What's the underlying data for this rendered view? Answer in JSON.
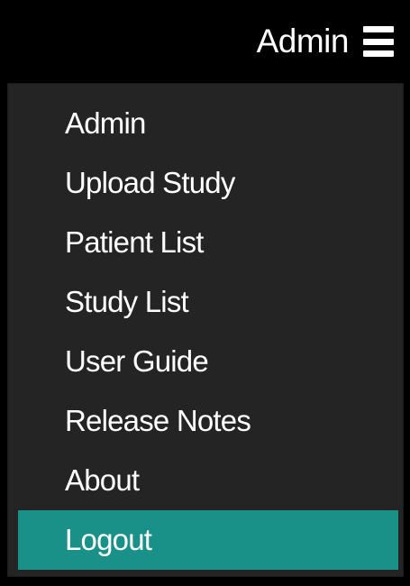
{
  "header": {
    "user_label": "Admin",
    "menu_icon": "hamburger-icon"
  },
  "menu": {
    "items": [
      {
        "label": "Admin"
      },
      {
        "label": "Upload Study"
      },
      {
        "label": "Patient List"
      },
      {
        "label": "Study List"
      },
      {
        "label": "User Guide"
      },
      {
        "label": "Release Notes"
      },
      {
        "label": "About"
      },
      {
        "label": "Logout",
        "highlighted": true
      }
    ]
  },
  "colors": {
    "background": "#000000",
    "menu_background": "#242424",
    "highlight": "#1a9188",
    "text": "#ffffff"
  }
}
